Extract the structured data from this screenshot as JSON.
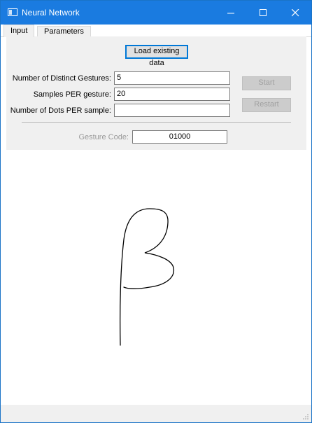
{
  "window": {
    "title": "Neural Network",
    "accent": "#1a7be0"
  },
  "tabs": [
    {
      "label": "Input",
      "active": true
    },
    {
      "label": "Parameters",
      "active": false
    }
  ],
  "form": {
    "load_button": "Load existing data",
    "fields": [
      {
        "label": "Number of Distinct Gestures:",
        "value": "5"
      },
      {
        "label": "Samples PER gesture:",
        "value": "20"
      },
      {
        "label": "Number of Dots PER sample:",
        "value": ""
      }
    ],
    "start_button": "Start",
    "restart_button": "Restart",
    "gesture_code_label": "Gesture Code:",
    "gesture_code_value": "01000"
  },
  "icons": {
    "app": "app-window-icon",
    "minimize": "minimize-icon",
    "maximize": "maximize-icon",
    "close": "close-icon"
  }
}
